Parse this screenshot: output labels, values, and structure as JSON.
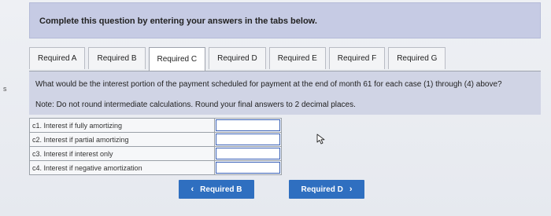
{
  "side_marker": "s",
  "instruction": "Complete this question by entering your answers in the tabs below.",
  "tabs": [
    {
      "label": "Required A"
    },
    {
      "label": "Required B"
    },
    {
      "label": "Required C",
      "active": true
    },
    {
      "label": "Required D"
    },
    {
      "label": "Required E"
    },
    {
      "label": "Required F"
    },
    {
      "label": "Required G"
    }
  ],
  "question": {
    "text": "What would be the interest portion of the payment scheduled for payment at the end of month 61 for each case (1) through (4) above?",
    "note": "Note: Do not round intermediate calculations. Round your final answers to 2 decimal places."
  },
  "answers": {
    "rows": [
      {
        "label": "c1. Interest if fully amortizing",
        "value": ""
      },
      {
        "label": "c2. Interest if partial amortizing",
        "value": ""
      },
      {
        "label": "c3. Interest if interest only",
        "value": ""
      },
      {
        "label": "c4. Interest if negative amortization",
        "value": ""
      }
    ]
  },
  "nav": {
    "prev_label": "Required B",
    "next_label": "Required D",
    "prev_chevron": "‹",
    "next_chevron": "›",
    "button_color": "#2f6fc0"
  },
  "icons": {
    "cursor": "mouse-pointer-icon"
  }
}
